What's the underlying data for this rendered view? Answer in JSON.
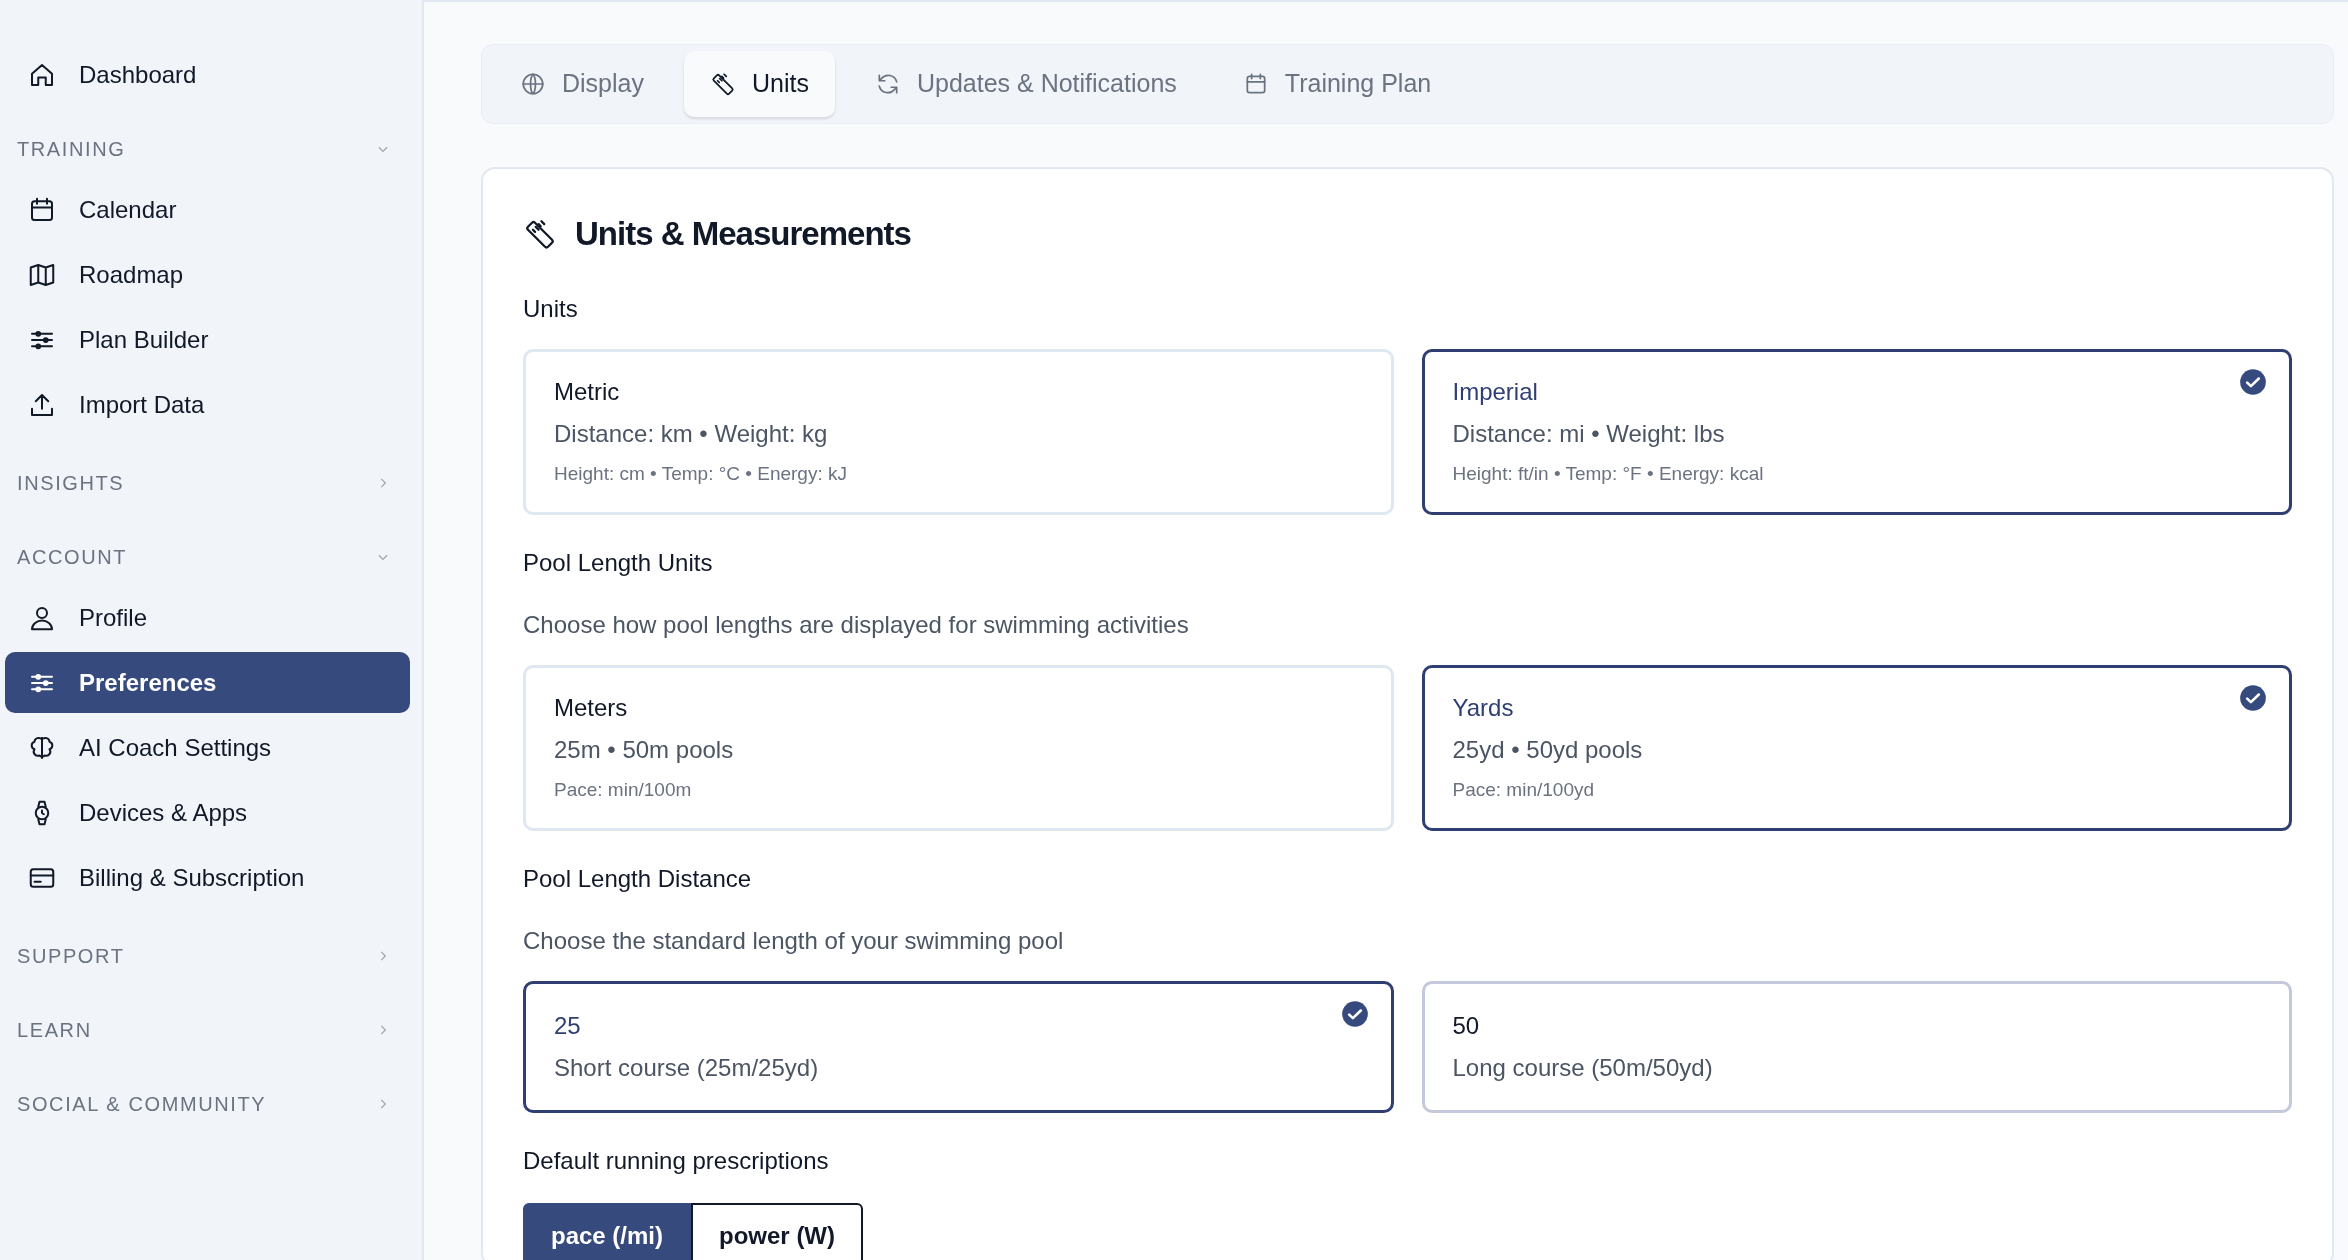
{
  "sidebar": {
    "items": [
      {
        "kind": "link",
        "label": "Dashboard",
        "selected": false
      },
      {
        "kind": "section",
        "label": "TRAINING",
        "expanded": true,
        "children": [
          {
            "label": "Calendar",
            "selected": false
          },
          {
            "label": "Roadmap",
            "selected": false
          },
          {
            "label": "Plan Builder",
            "selected": false
          },
          {
            "label": "Import Data",
            "selected": false
          }
        ]
      },
      {
        "kind": "section",
        "label": "INSIGHTS",
        "expanded": false
      },
      {
        "kind": "section",
        "label": "ACCOUNT",
        "expanded": true,
        "children": [
          {
            "label": "Profile",
            "selected": false
          },
          {
            "label": "Preferences",
            "selected": true
          },
          {
            "label": "AI Coach Settings",
            "selected": false
          },
          {
            "label": "Devices & Apps",
            "selected": false
          },
          {
            "label": "Billing & Subscription",
            "selected": false
          }
        ]
      },
      {
        "kind": "section",
        "label": "SUPPORT",
        "expanded": false
      },
      {
        "kind": "section",
        "label": "LEARN",
        "expanded": false
      },
      {
        "kind": "section",
        "label": "SOCIAL & COMMUNITY",
        "expanded": false
      }
    ]
  },
  "tabs": [
    {
      "label": "Display",
      "selected": false
    },
    {
      "label": "Units",
      "selected": true
    },
    {
      "label": "Updates & Notifications",
      "selected": false
    },
    {
      "label": "Training Plan",
      "selected": false
    }
  ],
  "panel": {
    "title": "Units & Measurements",
    "groups": [
      {
        "kind": "cards",
        "label": "Units",
        "options": [
          {
            "title": "Metric",
            "line": "Distance: km • Weight: kg",
            "note": "Height: cm • Temp: °C • Energy: kJ",
            "selected": false
          },
          {
            "title": "Imperial",
            "line": "Distance: mi • Weight: lbs",
            "note": "Height: ft/in • Temp: °F • Energy: kcal",
            "selected": true
          }
        ]
      },
      {
        "kind": "cards",
        "label": "Pool Length Units",
        "description": "Choose how pool lengths are displayed for swimming activities",
        "options": [
          {
            "title": "Meters",
            "line": "25m • 50m pools",
            "note": "Pace: min/100m",
            "selected": false
          },
          {
            "title": "Yards",
            "line": "25yd • 50yd pools",
            "note": "Pace: min/100yd",
            "selected": true
          }
        ]
      },
      {
        "kind": "cards",
        "label": "Pool Length Distance",
        "description": "Choose the standard length of your swimming pool",
        "options": [
          {
            "title": "25",
            "line": "Short course (25m/25yd)",
            "selected": true
          },
          {
            "title": "50",
            "line": "Long course (50m/50yd)",
            "selected": false
          }
        ]
      },
      {
        "kind": "segmented",
        "label": "Default running prescriptions",
        "options": [
          {
            "label": "pace (/mi)",
            "selected": true
          },
          {
            "label": "power (W)",
            "selected": false
          }
        ]
      }
    ]
  }
}
